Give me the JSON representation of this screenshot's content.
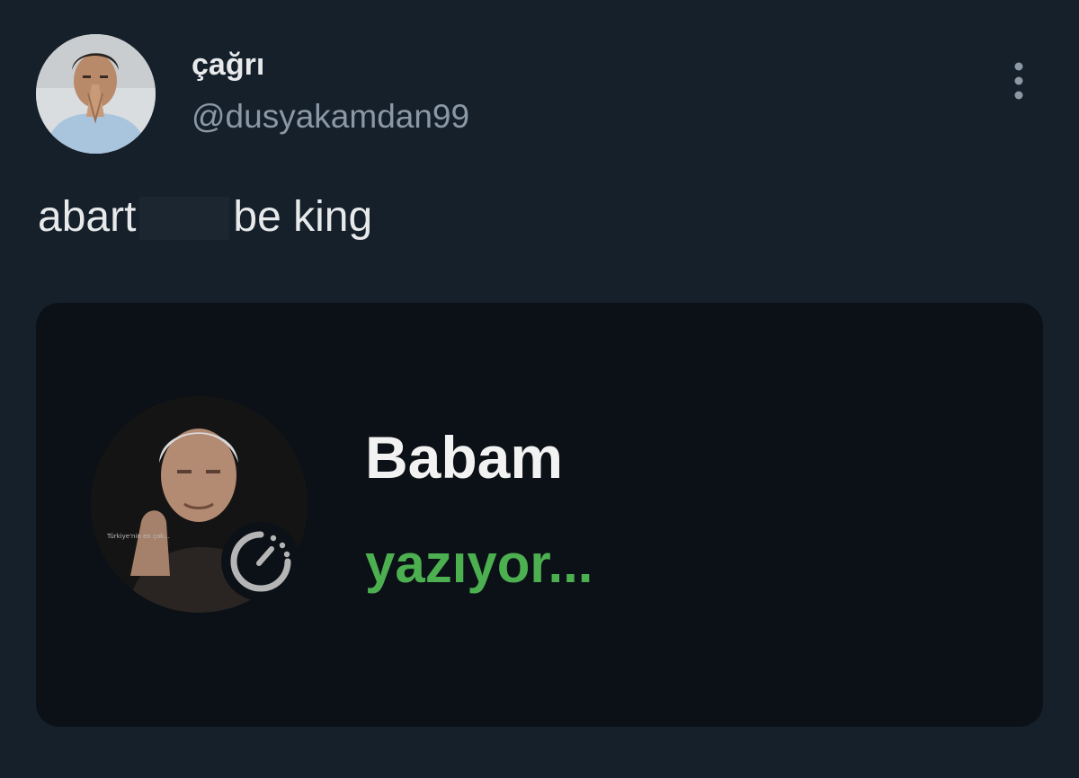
{
  "author": {
    "display_name": "çağrı",
    "handle": "@dusyakamdan99",
    "avatar_icon": "user-avatar-photo"
  },
  "tweet": {
    "text_before": "abart",
    "text_after": "be king"
  },
  "more_icon": "more-options-icon",
  "media": {
    "contact_name": "Babam",
    "status": "yazıyor...",
    "avatar_caption": "Türkiye'nin en çok...",
    "timer_icon": "disappearing-messages-timer-icon",
    "status_color": "#4caf50"
  },
  "colors": {
    "background": "#15202b",
    "media_background": "#0c1117",
    "primary_text": "#e7e9ea",
    "secondary_text": "#8b98a5"
  }
}
